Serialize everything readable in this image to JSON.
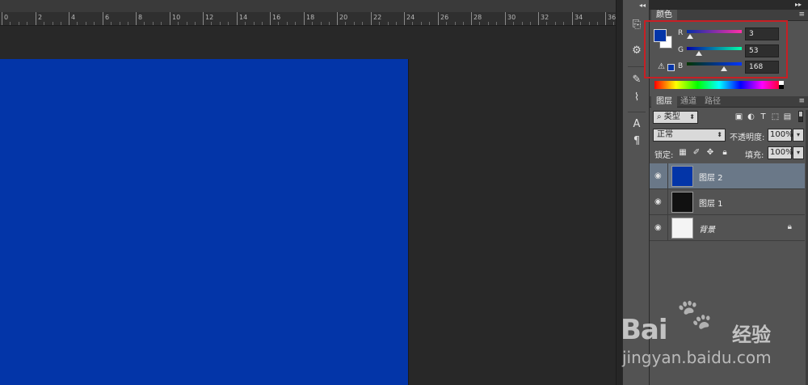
{
  "app": {
    "doc_color": "#0335a8",
    "accent_red": "#c81f24"
  },
  "ruler": {
    "labels": [
      "0",
      "2",
      "4",
      "6",
      "8",
      "10",
      "12",
      "14",
      "16",
      "18",
      "20",
      "22",
      "24",
      "26",
      "28",
      "30",
      "32",
      "34",
      "36"
    ]
  },
  "color_panel": {
    "tab_label": "颜色",
    "channels": [
      {
        "label": "R",
        "value": "3"
      },
      {
        "label": "G",
        "value": "53"
      },
      {
        "label": "B",
        "value": "168"
      }
    ],
    "fg_color": "#0335a8",
    "bg_color": "#ffffff"
  },
  "layers_panel": {
    "tabs": [
      "图层",
      "通道",
      "路径"
    ],
    "filter_kind": "类型",
    "blend_mode": "正常",
    "opacity_label": "不透明度:",
    "opacity_value": "100%",
    "lock_label": "锁定:",
    "fill_label": "填充:",
    "fill_value": "100%",
    "layers": [
      {
        "name": "图层 2",
        "thumb": "blue"
      },
      {
        "name": "图层 1",
        "thumb": "dark"
      },
      {
        "name": "背景",
        "thumb": "light"
      }
    ]
  },
  "watermark": {
    "brand": "Bai",
    "brand2": "经验",
    "url": "jingyan.baidu.com"
  }
}
